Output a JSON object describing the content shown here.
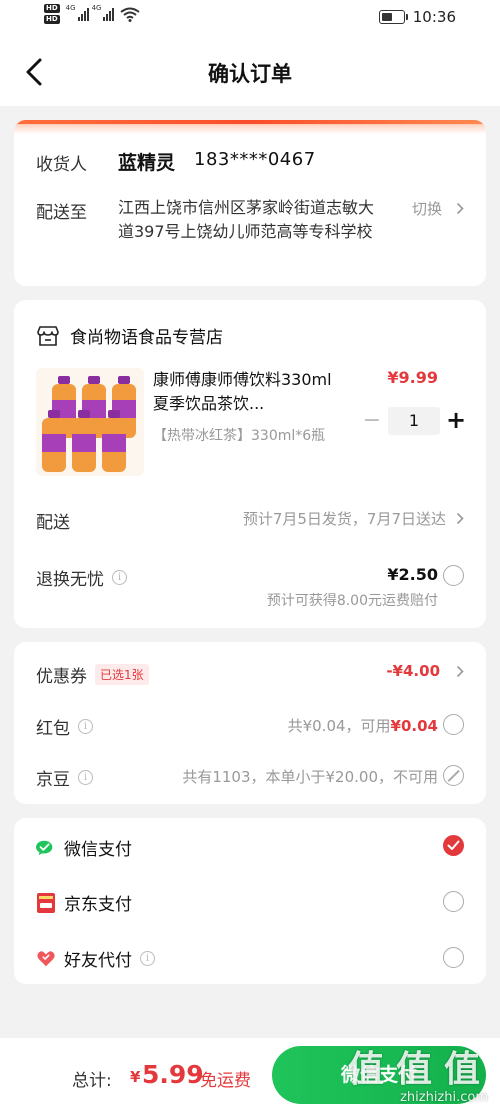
{
  "status_bar": {
    "hd_badges": [
      "HD",
      "HD"
    ],
    "network_1": "4G",
    "network_2": "4G",
    "battery_level": 0.45,
    "time": "10:36"
  },
  "nav": {
    "title": "确认订单",
    "back_icon": "chevron-left-icon"
  },
  "address": {
    "receiver_label": "收货人",
    "receiver_name": "蓝精灵",
    "receiver_phone": "183****0467",
    "deliver_label": "配送至",
    "address_text": "江西上饶市信州区茅家岭街道志敏大道397号上饶幼儿师范高等专科学校",
    "switch_label": "切换",
    "accent_color": "#f94e2b"
  },
  "order": {
    "store_icon": "store-icon",
    "store_name": "食尚物语食品专营店",
    "product": {
      "title": "康师傅康师傅饮料330ml夏季饮品茶饮...",
      "spec": "【热带冰红茶】330ml*6瓶",
      "price": "¥9.99",
      "quantity": "1",
      "minus_label": "−",
      "plus_label": "+"
    },
    "delivery_label": "配送",
    "delivery_info": "预计7月5日发货，7月7日送达",
    "return_label": "退换无忧",
    "return_price": "¥2.50",
    "return_note": "预计可获得8.00元运费赔付"
  },
  "discounts": {
    "coupon_label": "优惠券",
    "coupon_badge": "已选1张",
    "coupon_value": "-¥4.00",
    "redpack_label": "红包",
    "redpack_info_prefix": "共¥0.04，可用",
    "redpack_available": "¥0.04",
    "jd_bean_label": "京豆",
    "jd_bean_info": "共有1103，本单小于¥20.00，不可用"
  },
  "payment": {
    "methods": [
      {
        "label": "微信支付",
        "icon": "wechat-pay-icon",
        "checked": true
      },
      {
        "label": "京东支付",
        "icon": "jd-pay-icon",
        "checked": false
      },
      {
        "label": "好友代付",
        "icon": "friend-pay-icon",
        "checked": false
      }
    ]
  },
  "footer": {
    "total_label": "总计:",
    "currency": "¥",
    "total_amount": "5.99",
    "free_shipping": "免运费",
    "pay_button": "微信支付"
  },
  "watermark": {
    "glyphs": [
      "值",
      "值",
      "值"
    ],
    "url": "zhizhizhi.com"
  },
  "colors": {
    "accent_red": "#e4393c",
    "wechat_green": "#1fc45a",
    "page_bg": "#f2f2f2"
  }
}
